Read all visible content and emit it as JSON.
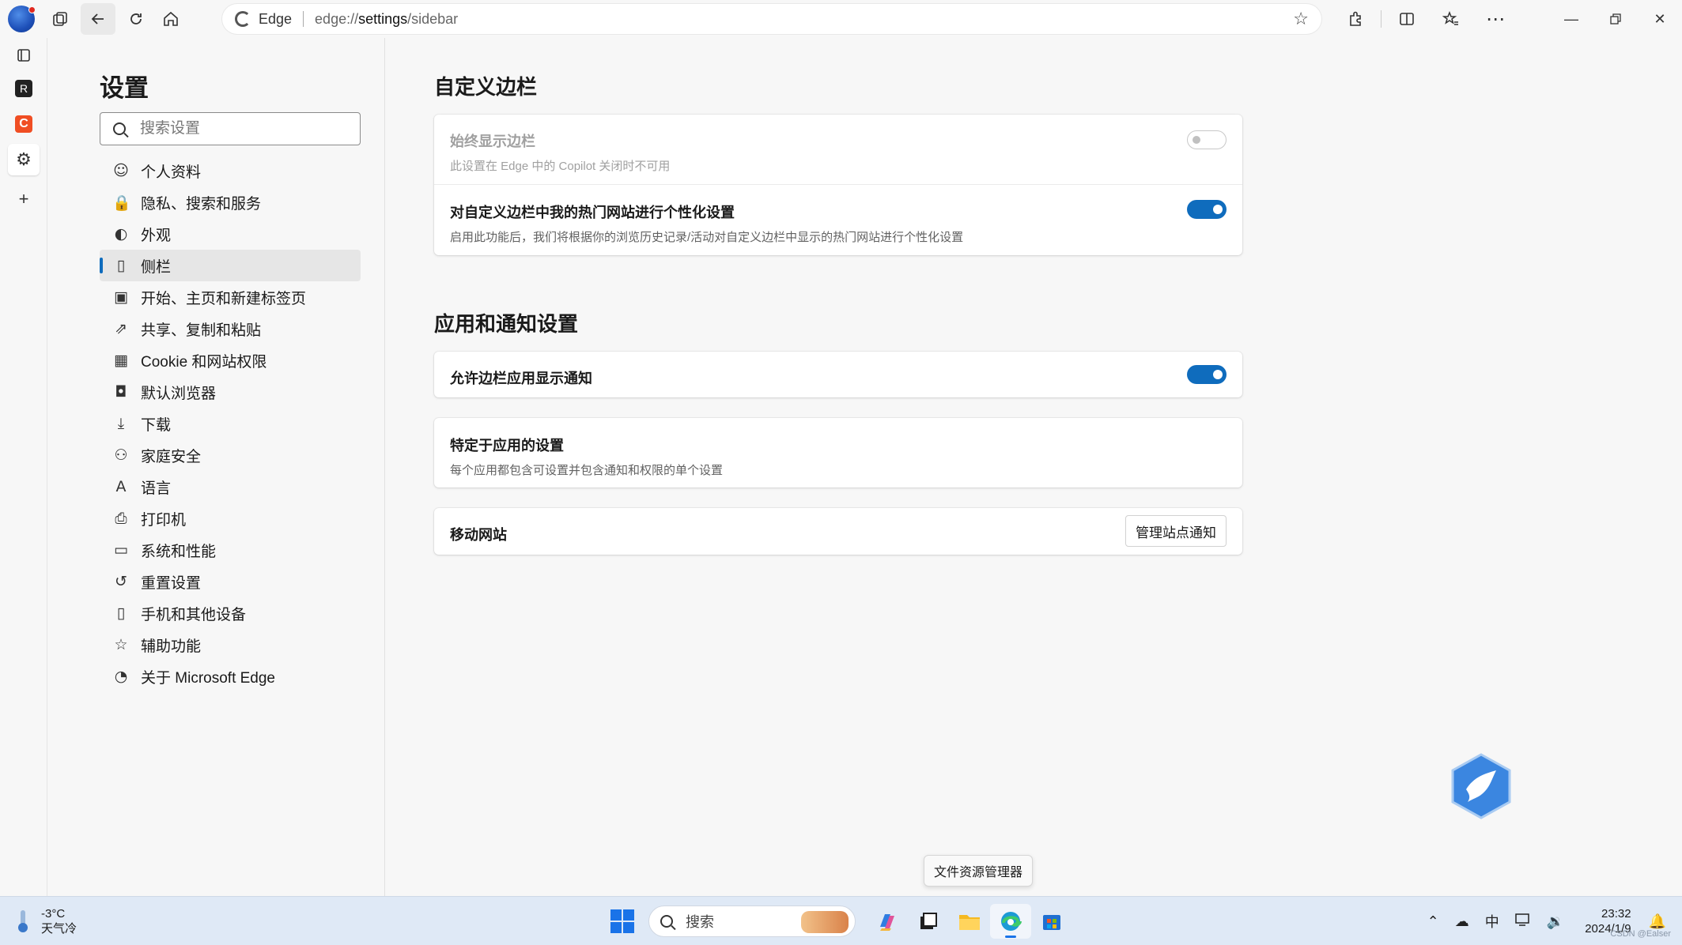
{
  "browser": {
    "address": {
      "brand": "Edge",
      "url_prefix": "edge://",
      "url_path": "settings",
      "url_suffix": "/sidebar"
    }
  },
  "settings_nav": {
    "title": "设置",
    "search_placeholder": "搜索设置",
    "items": [
      {
        "label": "个人资料",
        "icon": "profile-icon"
      },
      {
        "label": "隐私、搜索和服务",
        "icon": "lock-icon"
      },
      {
        "label": "外观",
        "icon": "palette-icon"
      },
      {
        "label": "侧栏",
        "icon": "sidebar-icon",
        "active": true
      },
      {
        "label": "开始、主页和新建标签页",
        "icon": "home-tabs-icon"
      },
      {
        "label": "共享、复制和粘贴",
        "icon": "share-icon"
      },
      {
        "label": "Cookie 和网站权限",
        "icon": "cookie-icon"
      },
      {
        "label": "默认浏览器",
        "icon": "browser-icon"
      },
      {
        "label": "下载",
        "icon": "download-icon"
      },
      {
        "label": "家庭安全",
        "icon": "family-icon"
      },
      {
        "label": "语言",
        "icon": "language-icon"
      },
      {
        "label": "打印机",
        "icon": "printer-icon"
      },
      {
        "label": "系统和性能",
        "icon": "laptop-icon"
      },
      {
        "label": "重置设置",
        "icon": "reset-icon"
      },
      {
        "label": "手机和其他设备",
        "icon": "phone-icon"
      },
      {
        "label": "辅助功能",
        "icon": "accessibility-icon"
      },
      {
        "label": "关于 Microsoft Edge",
        "icon": "edge-icon"
      }
    ]
  },
  "main": {
    "section1": {
      "title": "自定义边栏",
      "rows": [
        {
          "title": "始终显示边栏",
          "desc": "此设置在 Edge 中的 Copilot 关闭时不可用",
          "toggle": "off",
          "disabled": true
        },
        {
          "title": "对自定义边栏中我的热门网站进行个性化设置",
          "desc": "启用此功能后，我们将根据你的浏览历史记录/活动对自定义边栏中显示的热门网站进行个性化设置",
          "toggle": "on"
        }
      ]
    },
    "section2": {
      "title": "应用和通知设置",
      "notify_row": {
        "title": "允许边栏应用显示通知",
        "toggle": "on"
      },
      "app_row": {
        "title": "特定于应用的设置",
        "desc": "每个应用都包含可设置并包含通知和权限的单个设置"
      },
      "mobile_row": {
        "title": "移动网站",
        "button": "管理站点通知"
      }
    }
  },
  "tooltip": "文件资源管理器",
  "taskbar": {
    "weather_temp": "-3°C",
    "weather_desc": "天气冷",
    "search_placeholder": "搜索",
    "ime": "中",
    "time": "23:32",
    "date": "2024/1/9",
    "watermark": "CSDN @Ealser"
  },
  "colors": {
    "accent": "#0f6cbd",
    "taskbar": "#dfe9f6"
  }
}
